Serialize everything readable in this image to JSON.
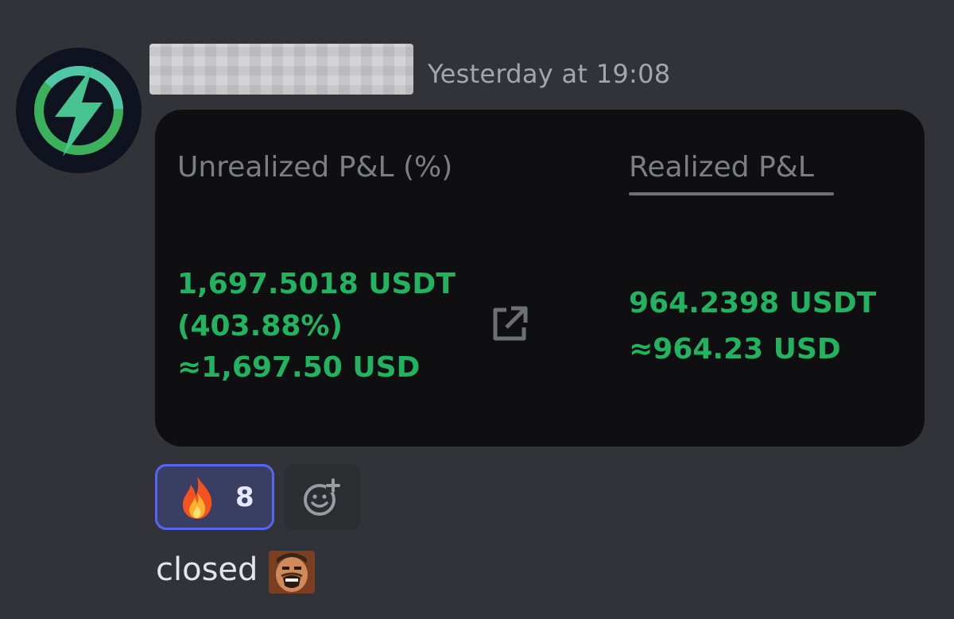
{
  "message": {
    "timestamp": "Yesterday at 19:08",
    "text": "closed",
    "inline_emoji": "laughing-man-emoji"
  },
  "avatar": {
    "icon": "lightning-bolt-icon",
    "colors": {
      "ring": "#3bb15c",
      "bolt": "#4fc7a6",
      "bg": "#0f1320"
    }
  },
  "card": {
    "unrealized": {
      "title": "Unrealized P&L (%)",
      "usdt": "1,697.5018 USDT",
      "percent": "(403.88%)",
      "usd": "≈1,697.50 USD"
    },
    "realized": {
      "title": "Realized P&L",
      "usdt": "964.2398 USDT",
      "usd": "≈964.23 USD"
    },
    "share_icon": "external-link-icon",
    "value_color": "#22b361"
  },
  "reactions": [
    {
      "emoji": "fire-emoji",
      "count": "8",
      "selected": true
    }
  ],
  "add_reaction_icon": "add-reaction-icon"
}
